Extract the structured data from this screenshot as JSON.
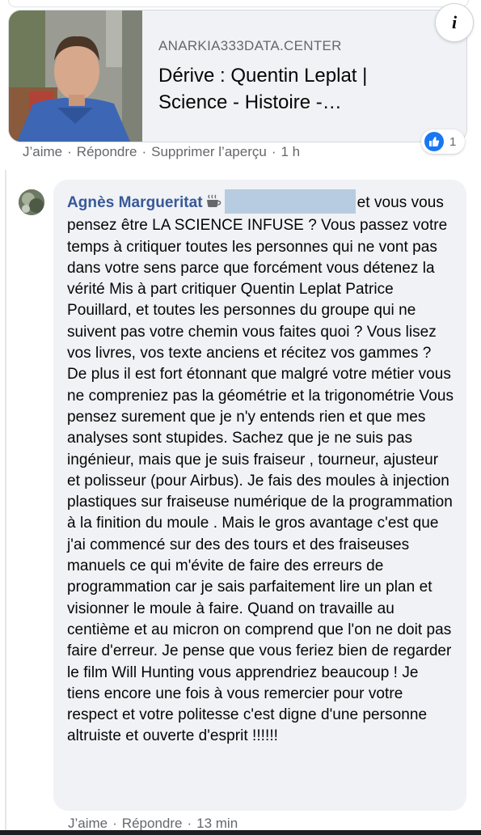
{
  "link_preview": {
    "domain": "ANARKIA333DATA.CENTER",
    "title_line1": "Dérive : Quentin Leplat |",
    "title_line2": "Science - Histoire -…",
    "info_icon": "info-icon"
  },
  "first_comment_actions": {
    "like": "J’aime",
    "reply": "Répondre",
    "remove_preview": "Supprimer l’aperçu",
    "time": "1 h",
    "separator": "·"
  },
  "reactions": {
    "icon": "like-icon",
    "count": "1",
    "color": "#1877f2"
  },
  "comment": {
    "author": "Agnès Margueritat",
    "badge_icon": "coffee-icon",
    "redacted_color": "#b7cce0",
    "author_color": "#385898",
    "text": "et vous vous pensez être LA SCIENCE INFUSE ? Vous passez votre temps à critiquer toutes les personnes qui ne vont pas dans votre sens parce que forcément vous détenez la vérité Mis à part critiquer Quentin Leplat Patrice Pouillard, et toutes les personnes du groupe qui ne suivent pas votre chemin vous faites quoi ? Vous lisez vos livres, vos texte anciens et récitez vos gammes ? De plus il est fort étonnant que malgré votre métier vous ne compreniez pas la géométrie et la trigonométrie Vous pensez surement que je n'y entends rien et que mes analyses sont stupides. Sachez que je ne suis pas ingénieur, mais que je suis fraiseur , tourneur, ajusteur et polisseur (pour Airbus). Je fais des moules à injection plastiques sur fraiseuse numérique de la programmation à la finition du moule . Mais le gros avantage c'est que j'ai commencé sur des des tours et des fraiseuses manuels ce qui m'évite de faire des erreurs de programmation car je sais parfaitement lire un plan et visionner le moule à faire. Quand on travaille au centième et au micron on comprend que l'on ne doit pas faire d'erreur. Je pense que vous feriez bien de regarder le film Will Hunting vous apprendriez beaucoup ! Je tiens encore une fois à vous remercier pour votre respect et votre politesse c'est digne d'une personne altruiste et ouverte d'esprit !!!!!!"
  },
  "second_comment_actions": {
    "like": "J’aime",
    "reply": "Répondre",
    "time": "13 min",
    "separator": "·"
  }
}
